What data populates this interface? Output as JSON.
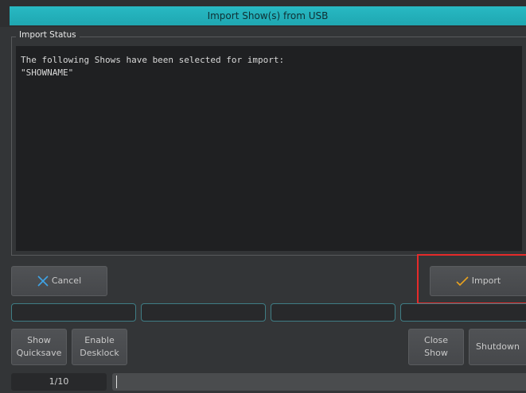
{
  "window": {
    "title": "Import Show(s) from USB"
  },
  "status_group": {
    "label": "Import Status",
    "lines": [
      "The following Shows have been selected for import:",
      "\"SHOWNAME\""
    ]
  },
  "actions": {
    "cancel_label": "Cancel",
    "import_label": "Import"
  },
  "bottom_buttons": {
    "show_quicksave": [
      "Show",
      "Quicksave"
    ],
    "enable_desklock": [
      "Enable",
      "Desklock"
    ],
    "close_show": [
      "Close",
      "Show"
    ],
    "shutdown": "Shutdown"
  },
  "footer": {
    "page": "1/10",
    "command_line": ""
  },
  "colors": {
    "title_bar": "#22b1bb",
    "highlight": "#e52a2a",
    "cancel_icon": "#3fa3e6",
    "import_icon": "#e8a21f",
    "slot_border": "#3f7d85"
  },
  "icons": {
    "cancel": "x-icon",
    "import": "checkmark-icon"
  }
}
